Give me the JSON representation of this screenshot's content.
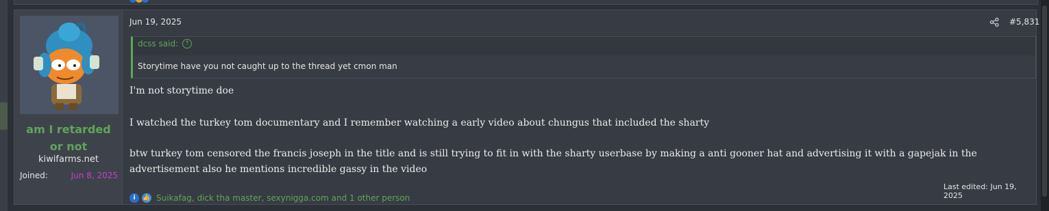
{
  "post": {
    "username_line1": "am I retarded",
    "username_line2": "or not",
    "user_title": "kiwifarms.net",
    "joined_label": "Joined:",
    "joined_value": "Jun 8, 2025",
    "date": "Jun 19, 2025",
    "post_number": "#5,831",
    "quote": {
      "author": "dcss said:",
      "text": "Storytime have you not caught up to the thread yet cmon man"
    },
    "message": [
      "I'm not storytime doe",
      "I watched the turkey tom documentary and I remember watching a early video about chungus that included the sharty",
      "btw turkey tom censored the francis joseph in the title and is still trying to fit in with the sharty userbase by making a anti gooner hat and advertising it with a gapejak in the advertisement also he mentions incredible gassy in the video"
    ],
    "last_edited": "Last edited: Jun 19, 2025",
    "reactions_text": "Suikafag, dick tha master, sexynigga.com and 1 other person",
    "reaction_icons": [
      "informative-icon",
      "like-icon"
    ]
  },
  "colors": {
    "accent_green": "#5fa55a",
    "joined_magenta": "#c43fd2",
    "post_bg": "#373b43",
    "page_bg": "#2c3037"
  }
}
